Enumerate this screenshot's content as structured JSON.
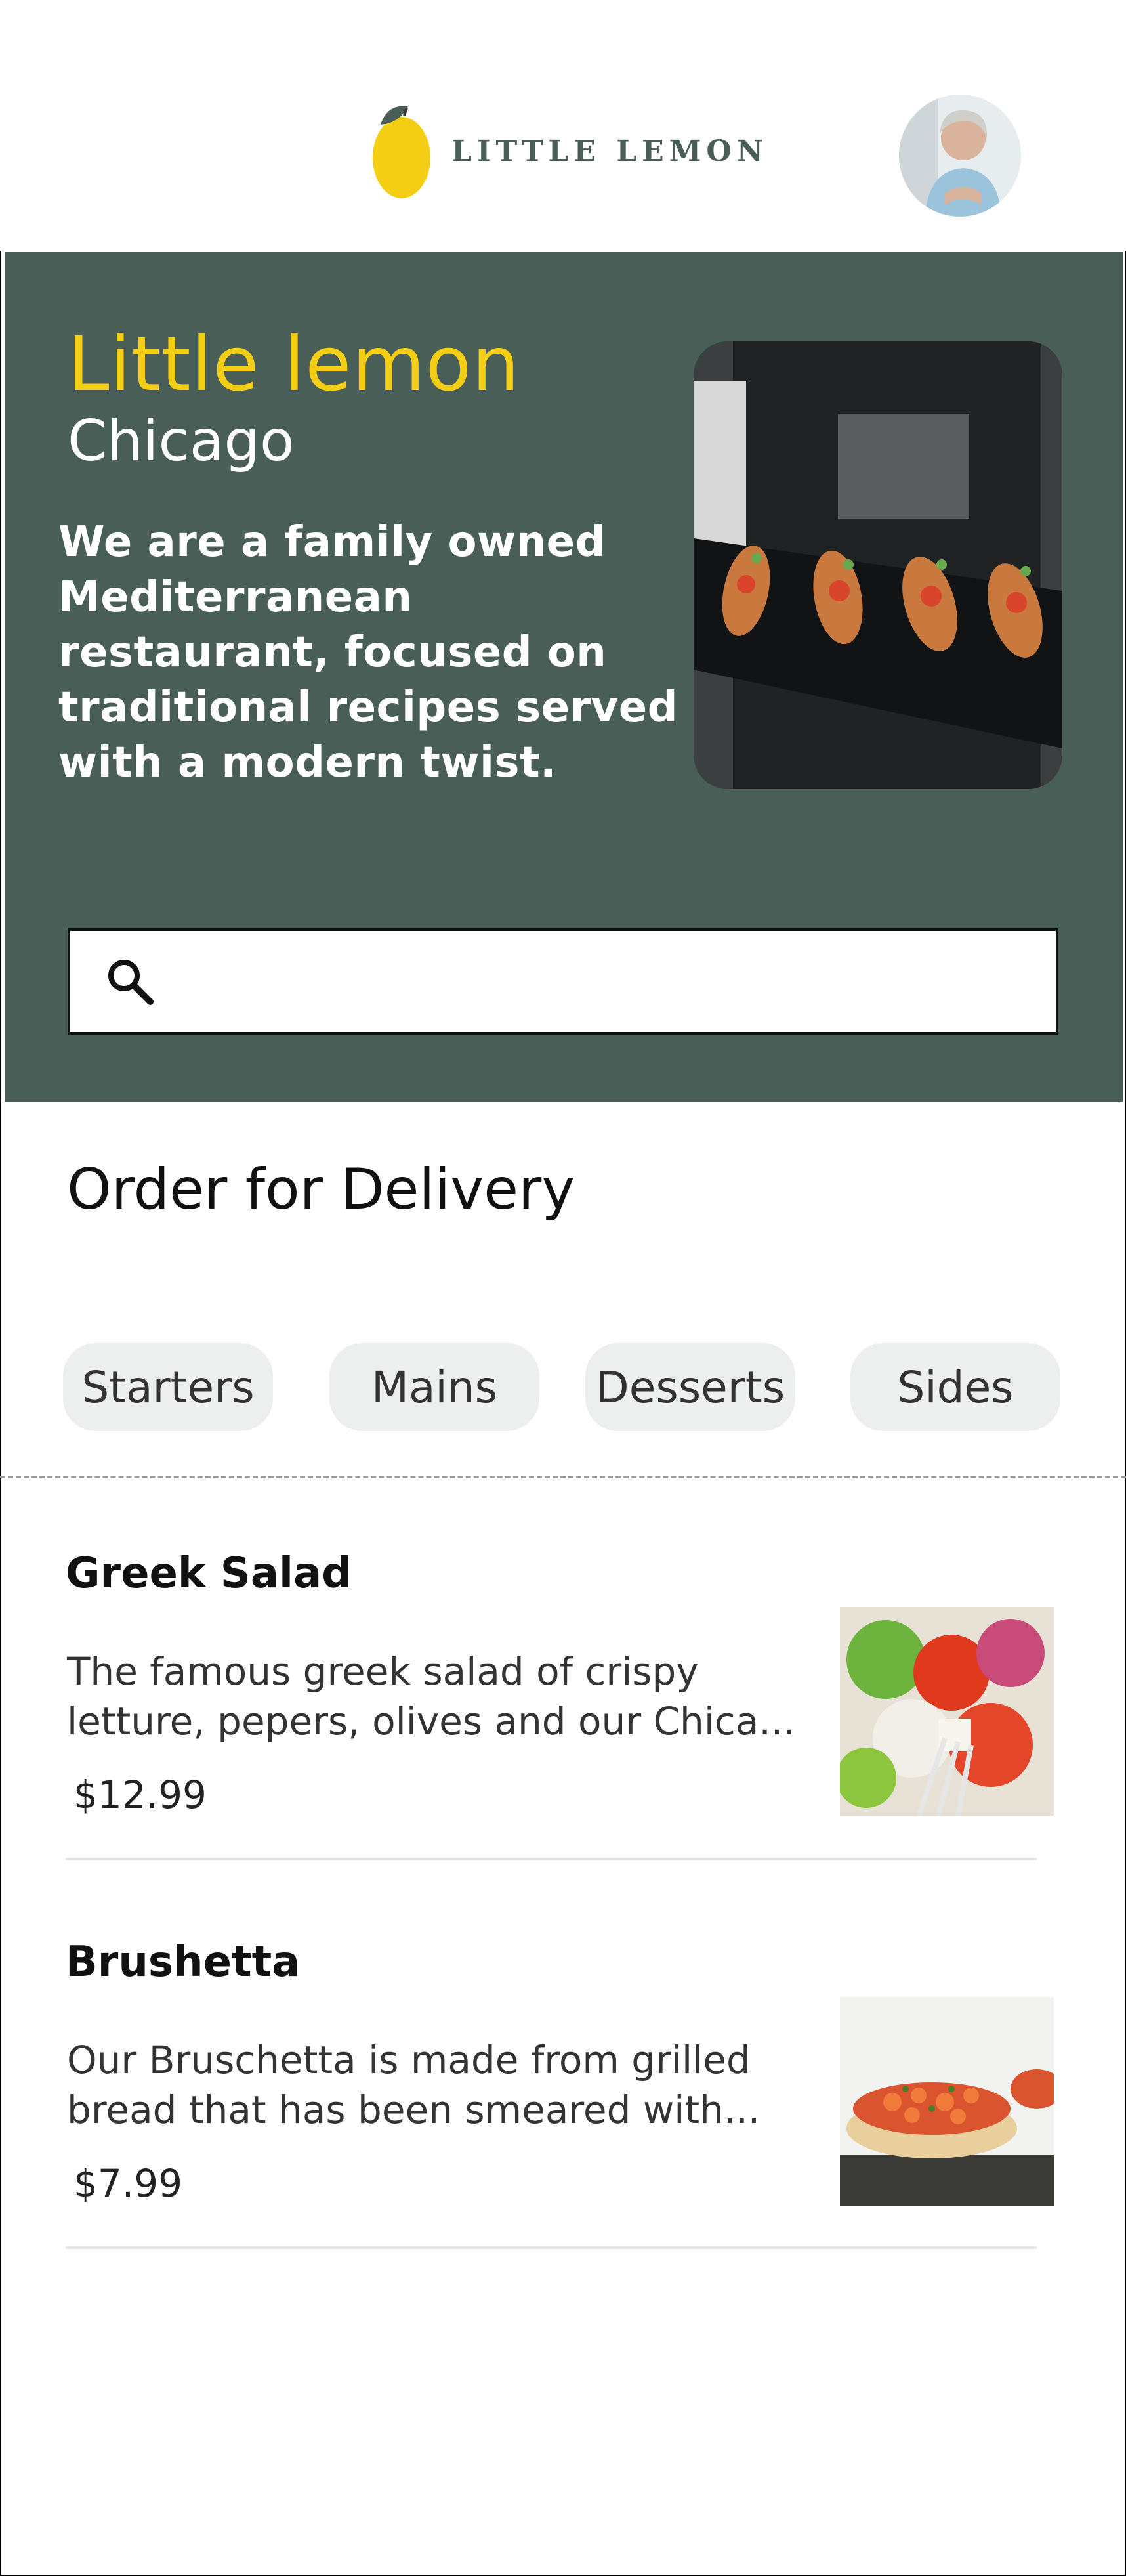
{
  "header": {
    "logo_text": "LITTLE LEMON",
    "logo_icon": "lemon-icon",
    "avatar_icon": "profile-avatar"
  },
  "hero": {
    "title": "Little lemon",
    "subtitle": "Chicago",
    "description": "We are a family owned Mediterranean restaurant, focused on traditional recipes served with a modern twist.",
    "image_icon": "hero-food-photo",
    "search_placeholder": "",
    "search_icon": "search-icon"
  },
  "order": {
    "title": "Order for Delivery",
    "categories": [
      "Starters",
      "Mains",
      "Desserts",
      "Sides"
    ]
  },
  "menu": [
    {
      "name": "Greek Salad",
      "description": "The famous greek salad of crispy letture, pepers, olives and our Chica...",
      "price": "$12.99"
    },
    {
      "name": "Brushetta",
      "description": "Our Bruschetta is made from grilled bread that has been smeared with...",
      "price": "$7.99"
    }
  ],
  "colors": {
    "primary_green": "#495E57",
    "primary_yellow": "#F4CE14",
    "chip_bg": "#EDEFEE"
  }
}
